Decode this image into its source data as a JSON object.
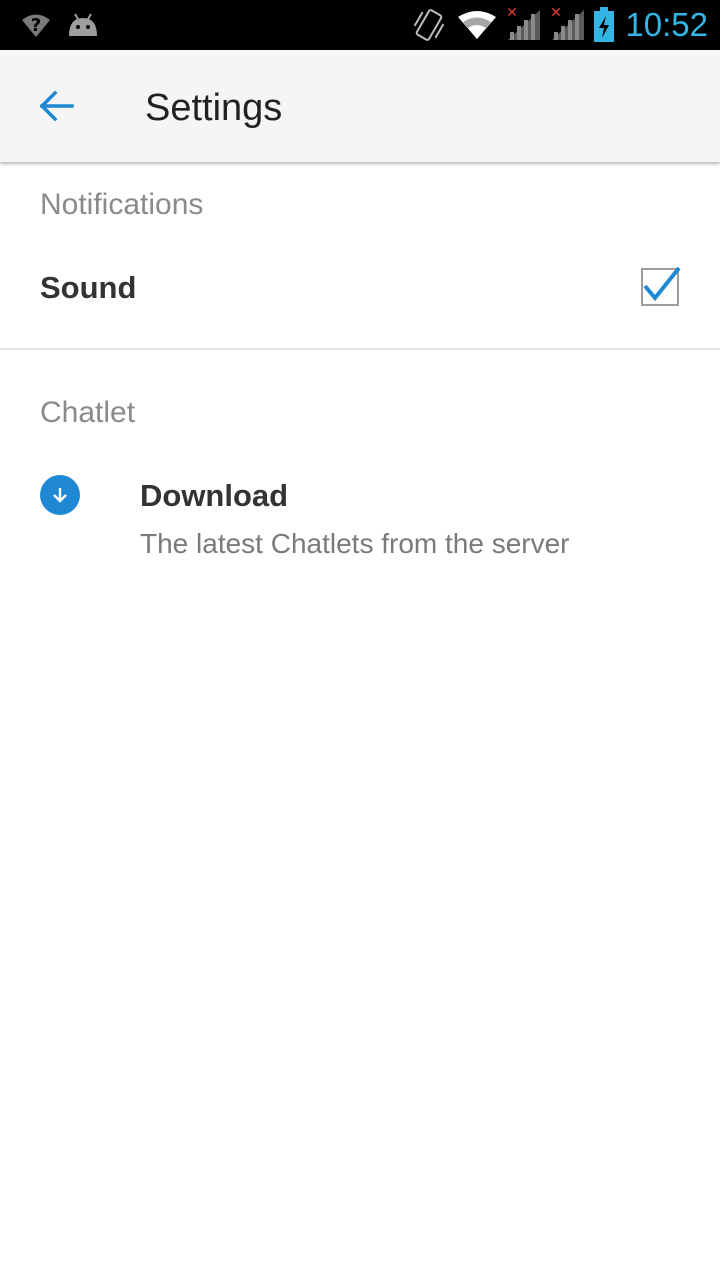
{
  "status_bar": {
    "time": "10:52",
    "icons": [
      "wifi-question-icon",
      "android-debug-icon",
      "vibrate-icon",
      "wifi-icon",
      "signal-no-service-icon",
      "signal-no-service-icon-2",
      "battery-charging-icon"
    ]
  },
  "toolbar": {
    "back_icon": "arrow-back-icon",
    "title": "Settings"
  },
  "sections": [
    {
      "header": "Notifications",
      "items": [
        {
          "title": "Sound",
          "checked": true
        }
      ]
    },
    {
      "header": "Chatlet",
      "items": [
        {
          "icon": "download-icon",
          "title": "Download",
          "summary": "The latest Chatlets from the server"
        }
      ]
    }
  ],
  "colors": {
    "accent": "#1e88d2",
    "status_time": "#33b5e5",
    "toolbar_bg": "#f5f5f5",
    "status_bar_bg": "#000000",
    "error_red": "#e53935"
  }
}
